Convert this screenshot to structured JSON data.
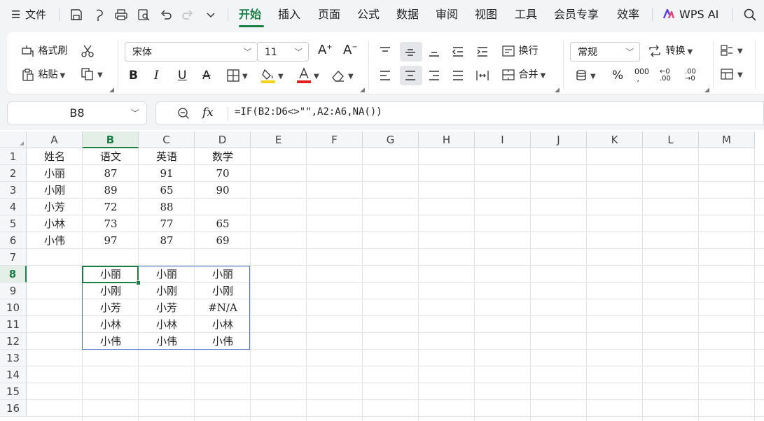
{
  "menu": {
    "file_label": "文件",
    "tabs": [
      "开始",
      "插入",
      "页面",
      "公式",
      "数据",
      "审阅",
      "视图",
      "工具",
      "会员专享",
      "效率"
    ],
    "active_tab": "开始",
    "wps_ai_label": "WPS AI"
  },
  "ribbon": {
    "format_painter": "格式刷",
    "paste": "粘贴",
    "font_name": "宋体",
    "font_size": "11",
    "wrap_text": "换行",
    "merge": "合并",
    "number_format": "常规",
    "convert": "转换"
  },
  "formula_bar": {
    "name_box": "B8",
    "fx_label": "fx",
    "formula": "=IF(B2:D6<>\"\",A2:A6,NA())"
  },
  "sheet": {
    "columns": [
      "A",
      "B",
      "C",
      "D",
      "E",
      "F",
      "G",
      "H",
      "I",
      "J",
      "K",
      "L",
      "M"
    ],
    "rows": [
      "1",
      "2",
      "3",
      "4",
      "5",
      "6",
      "7",
      "8",
      "9",
      "10",
      "11",
      "12",
      "13",
      "14",
      "15",
      "16"
    ],
    "selected_column": "B",
    "selected_row": "8",
    "table": [
      [
        "姓名",
        "语文",
        "英语",
        "数学"
      ],
      [
        "小丽",
        "87",
        "91",
        "70"
      ],
      [
        "小刚",
        "89",
        "65",
        "90"
      ],
      [
        "小芳",
        "72",
        "88",
        ""
      ],
      [
        "小林",
        "73",
        "77",
        "65"
      ],
      [
        "小伟",
        "97",
        "87",
        "69"
      ]
    ],
    "result": [
      [
        "小丽",
        "小丽",
        "小丽"
      ],
      [
        "小刚",
        "小刚",
        "小刚"
      ],
      [
        "小芳",
        "小芳",
        "#N/A"
      ],
      [
        "小林",
        "小林",
        "小林"
      ],
      [
        "小伟",
        "小伟",
        "小伟"
      ]
    ]
  }
}
